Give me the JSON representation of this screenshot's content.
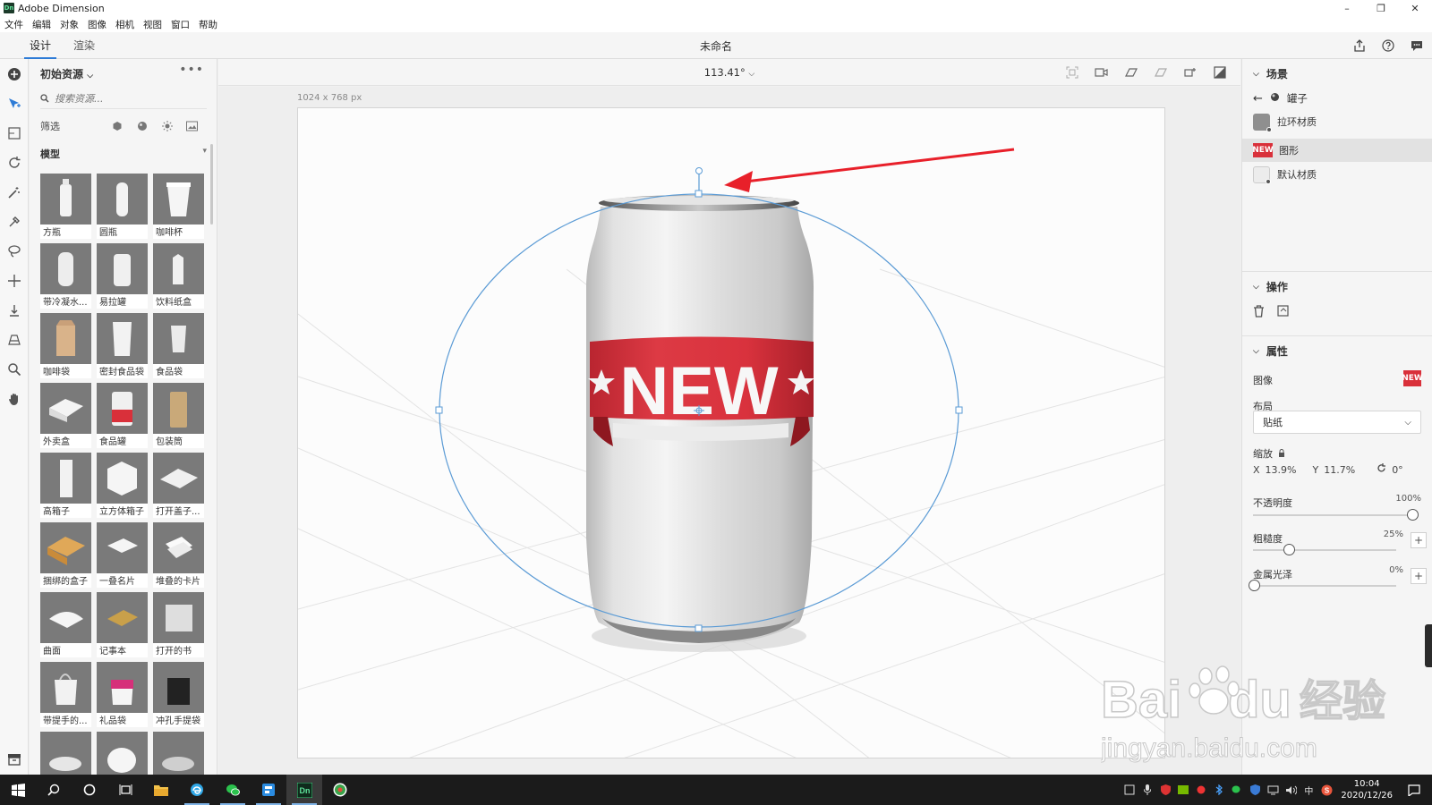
{
  "window": {
    "app_logo": "Dn",
    "app_title": "Adobe Dimension",
    "controls": [
      "–",
      "❐",
      "✕"
    ]
  },
  "menu": [
    "文件",
    "编辑",
    "对象",
    "图像",
    "相机",
    "视图",
    "窗口",
    "帮助"
  ],
  "top_tabs": [
    {
      "label": "设计",
      "active": true
    },
    {
      "label": "渲染",
      "active": false
    }
  ],
  "document_title": "未命名",
  "assets": {
    "title": "初始资源",
    "more": "•••",
    "search_placeholder": "搜索资源...",
    "filter_label": "筛选",
    "section_label": "模型",
    "items": [
      "方瓶",
      "圆瓶",
      "咖啡杯",
      "带冷凝水...",
      "易拉罐",
      "饮料纸盒",
      "咖啡袋",
      "密封食品袋",
      "食品袋",
      "外卖盒",
      "食品罐",
      "包装筒",
      "高箱子",
      "立方体箱子",
      "打开盖子...",
      "捆绑的盒子",
      "一叠名片",
      "堆叠的卡片",
      "曲面",
      "记事本",
      "打开的书",
      "带提手的...",
      "礼品袋",
      "冲孔手提袋",
      "",
      "",
      ""
    ]
  },
  "viewport": {
    "zoom": "113.41°",
    "canvas_size": "1024 x 768 px",
    "label_text": "NEW"
  },
  "scene": {
    "title": "场景",
    "object": "罐子",
    "layers": [
      {
        "label": "拉环材质",
        "swatch": "#8f8f8f",
        "selected": false
      },
      {
        "label": "图形",
        "swatch": "#d9303a",
        "selected": true
      },
      {
        "label": "默认材质",
        "swatch": "#ececec",
        "selected": false
      }
    ]
  },
  "actions": {
    "title": "操作"
  },
  "properties": {
    "title": "属性",
    "image_label": "图像",
    "image_thumb": "NEW",
    "layout_label": "布局",
    "layout_value": "贴纸",
    "scale_label": "缩放",
    "x_label": "X",
    "x_value": "13.9%",
    "y_label": "Y",
    "y_value": "11.7%",
    "rotation_value": "0°",
    "opacity_label": "不透明度",
    "opacity_value": "100%",
    "opacity": 1.0,
    "roughness_label": "粗糙度",
    "roughness_value": "25%",
    "roughness": 0.25,
    "metallic_label": "金属光泽",
    "metallic_value": "0%",
    "metallic": 0.0
  },
  "taskbar": {
    "time": "10:04",
    "date": "2020/12/26",
    "ime": "中"
  },
  "watermark": {
    "line1": "Bai",
    "line2": "du",
    "line3": "经验",
    "url": "jingyan.baidu.com"
  },
  "colors": {
    "accent": "#2d7bd6",
    "label_red": "#d9303a",
    "arrow_red": "#e8202a"
  }
}
